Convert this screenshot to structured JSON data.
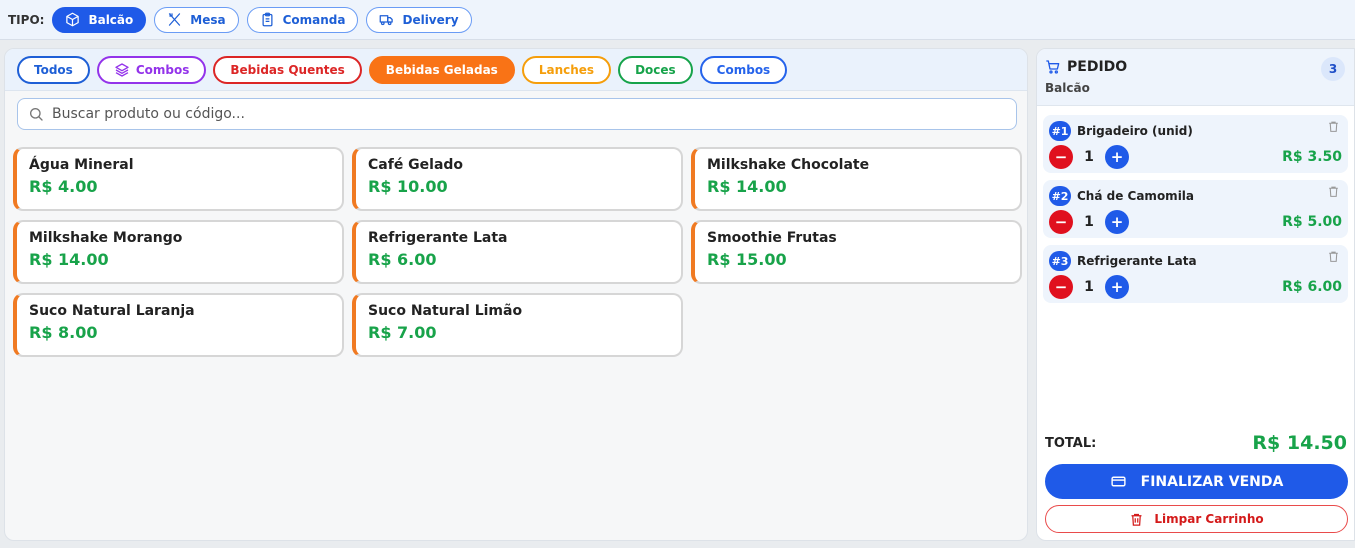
{
  "topbar": {
    "label": "TIPO:",
    "types": [
      {
        "label": "Balcão",
        "icon": "box-icon",
        "active": true
      },
      {
        "label": "Mesa",
        "icon": "utensils-icon",
        "active": false
      },
      {
        "label": "Comanda",
        "icon": "clipboard-icon",
        "active": false
      },
      {
        "label": "Delivery",
        "icon": "truck-icon",
        "active": false
      }
    ]
  },
  "filters": [
    {
      "label": "Todos",
      "color": "#1e5fd6",
      "active": false
    },
    {
      "label": "Combos",
      "color": "#9333ea",
      "icon": "layers-icon",
      "active": false
    },
    {
      "label": "Bebidas Quentes",
      "color": "#dc2626",
      "active": false
    },
    {
      "label": "Bebidas Geladas",
      "color": "#f97316",
      "active": true
    },
    {
      "label": "Lanches",
      "color": "#f59e0b",
      "active": false
    },
    {
      "label": "Doces",
      "color": "#16a34a",
      "active": false
    },
    {
      "label": "Combos",
      "color": "#2563eb",
      "active": false
    }
  ],
  "search": {
    "placeholder": "Buscar produto ou código..."
  },
  "products": [
    {
      "name": "Água Mineral",
      "price": "R$ 4.00"
    },
    {
      "name": "Café Gelado",
      "price": "R$ 10.00"
    },
    {
      "name": "Milkshake Chocolate",
      "price": "R$ 14.00"
    },
    {
      "name": "Milkshake Morango",
      "price": "R$ 14.00"
    },
    {
      "name": "Refrigerante Lata",
      "price": "R$ 6.00"
    },
    {
      "name": "Smoothie Frutas",
      "price": "R$ 15.00"
    },
    {
      "name": "Suco Natural Laranja",
      "price": "R$ 8.00"
    },
    {
      "name": "Suco Natural Limão",
      "price": "R$ 7.00"
    }
  ],
  "order": {
    "title": "PEDIDO",
    "subtitle": "Balcão",
    "count": "3",
    "items": [
      {
        "num": "#1",
        "name": "Brigadeiro (unid)",
        "qty": "1",
        "price": "R$ 3.50"
      },
      {
        "num": "#2",
        "name": "Chá de Camomila",
        "qty": "1",
        "price": "R$ 5.00"
      },
      {
        "num": "#3",
        "name": "Refrigerante Lata",
        "qty": "1",
        "price": "R$ 6.00"
      }
    ],
    "total_label": "TOTAL:",
    "total_value": "R$ 14.50",
    "finalize_label": "FINALIZAR VENDA",
    "clear_label": "Limpar Carrinho"
  }
}
